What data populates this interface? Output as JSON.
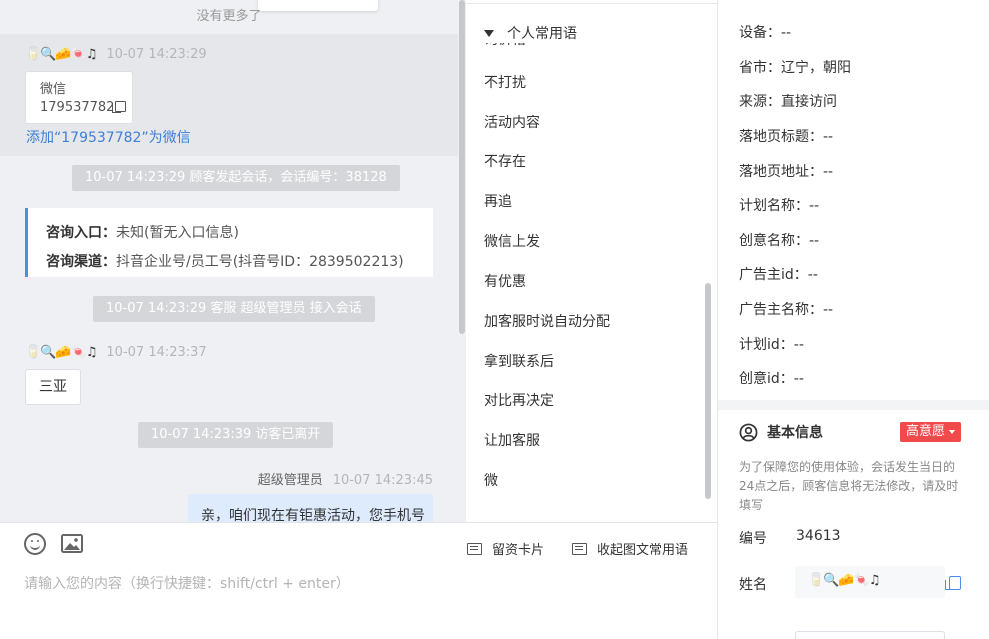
{
  "chat": {
    "no_more": "没有更多了",
    "msg1": {
      "sender": "🥛🔍🧀🍬♫",
      "time": "10-07 14:23:29",
      "card_title": "微信",
      "card_id": "179537782",
      "add_link": "添加“179537782”为微信"
    },
    "sys1": "10-07 14:23:29 顾客发起会话，会话编号：38128",
    "consult": {
      "entry_label": "咨询入口：",
      "entry_value": "未知(暂无入口信息)",
      "channel_label": "咨询渠道：",
      "channel_value": "抖音企业号/员工号(抖音号ID：2839502213)"
    },
    "sys2": "10-07 14:23:29 客服 超级管理员 接入会话",
    "msg2": {
      "sender": "🥛🔍🧀🍬♫",
      "time": "10-07 14:23:37",
      "text": "三亚"
    },
    "sys3": "10-07 14:23:39 访客已离开",
    "agent_msg": {
      "sender": "超级管理员",
      "time": "10-07 14:23:45",
      "text": "亲，咱们现在有钜惠活动，您手机号"
    }
  },
  "phrases": {
    "group": "个人常用语",
    "cut_item": "询价格",
    "items": [
      "不打扰",
      "活动内容",
      "不存在",
      "再追",
      "微信上发",
      "有优惠",
      "加客服时说自动分配",
      "拿到联系后",
      "对比再决定",
      "让加客服",
      "微"
    ]
  },
  "composer": {
    "card_button": "留资卡片",
    "collapse_button": "收起图文常用语",
    "placeholder": "请输入您的内容（换行快捷键：shift/ctrl + enter）"
  },
  "visitor": {
    "fields": [
      {
        "label": "设备：",
        "value": "--"
      },
      {
        "label": "省市：",
        "value": "辽宁，朝阳"
      },
      {
        "label": "来源：",
        "value": "直接访问"
      },
      {
        "label": "落地页标题：",
        "value": "--"
      },
      {
        "label": "落地页地址：",
        "value": "--"
      },
      {
        "label": "计划名称：",
        "value": "--"
      },
      {
        "label": "创意名称：",
        "value": "--"
      },
      {
        "label": "广告主id：",
        "value": "--"
      },
      {
        "label": "广告主名称：",
        "value": "--"
      },
      {
        "label": "计划id：",
        "value": "--"
      },
      {
        "label": "创意id：",
        "value": "--"
      }
    ]
  },
  "basic": {
    "title": "基本信息",
    "intent": "高意愿",
    "notice": "为了保障您的使用体验，会话发生当日的24点之后，顾客信息将无法修改，请及时填写",
    "id_label": "编号",
    "id_value": "34613",
    "name_label": "姓名",
    "name_value": "🥛🔍🧀🍬♫"
  },
  "colors": {
    "accent_blue": "#4a8ee8",
    "badge_red": "#f04a4a",
    "agent_bubble": "#ddebfd"
  }
}
